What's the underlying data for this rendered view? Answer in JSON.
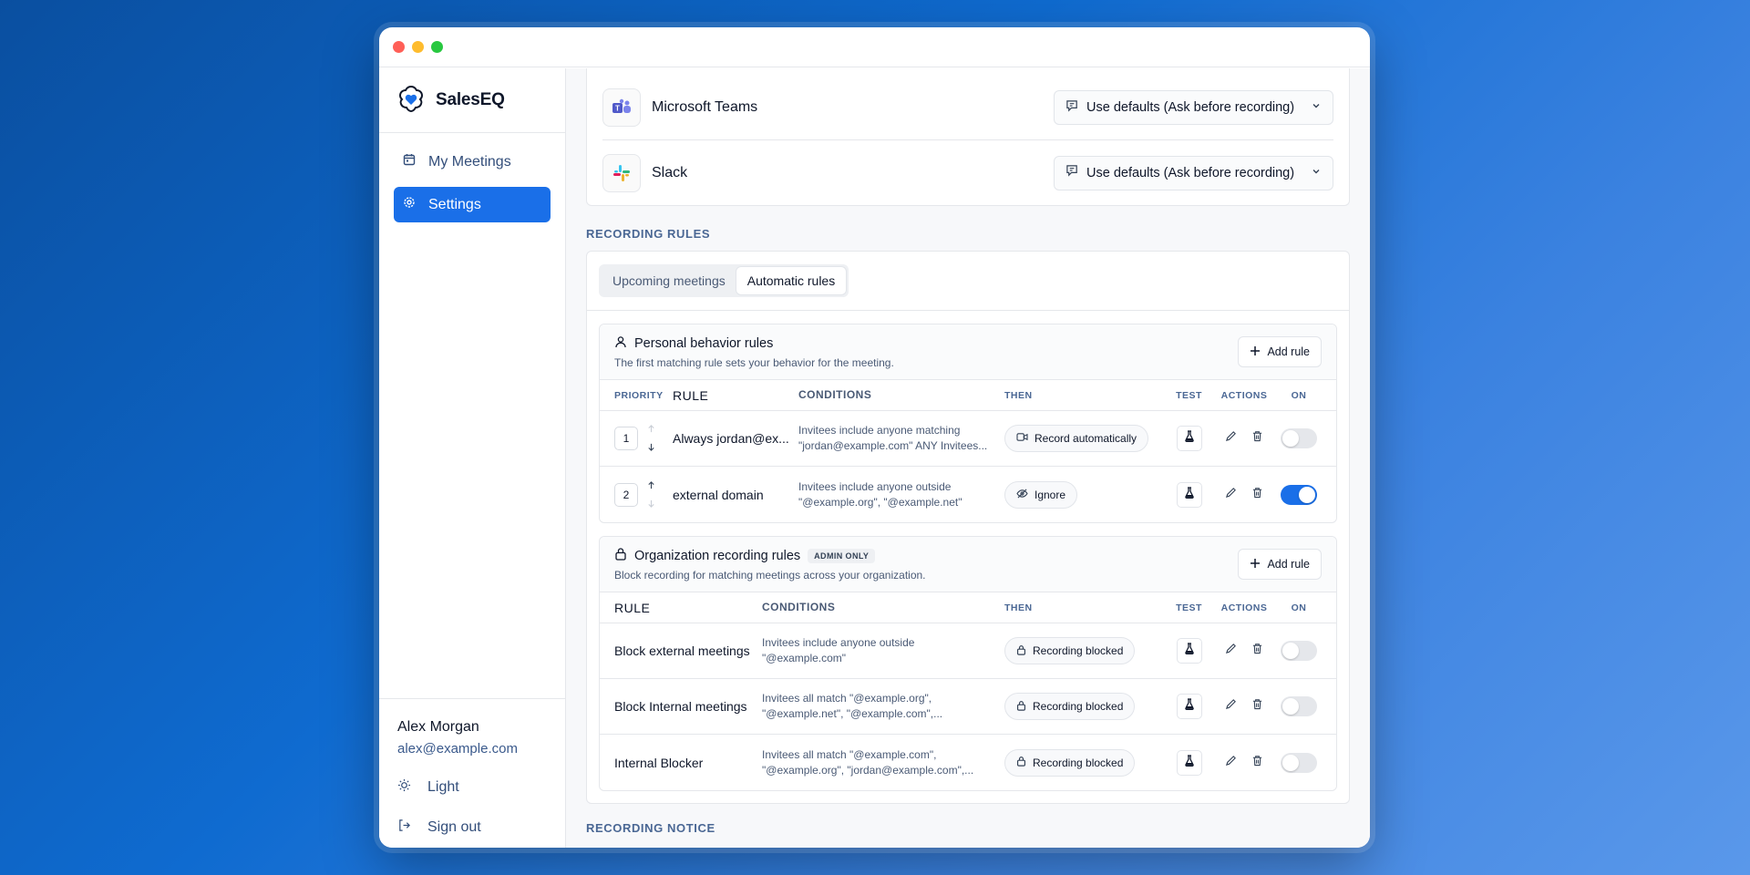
{
  "brand": {
    "name": "SalesEQ"
  },
  "nav": {
    "meetings": "My Meetings",
    "settings": "Settings"
  },
  "user": {
    "name": "Alex Morgan",
    "email": "alex@example.com"
  },
  "footer": {
    "theme": "Light",
    "signout": "Sign out"
  },
  "integrations": [
    {
      "name": "Microsoft Teams",
      "value": "Use defaults (Ask before recording)"
    },
    {
      "name": "Slack",
      "value": "Use defaults (Ask before recording)"
    }
  ],
  "recording_rules": {
    "title": "RECORDING RULES",
    "tabs": [
      "Upcoming meetings",
      "Automatic rules"
    ],
    "active_tab": "Automatic rules"
  },
  "personal": {
    "title": "Personal behavior rules",
    "subtitle": "The first matching rule sets your behavior for the meeting.",
    "add_label": "Add rule",
    "headers": {
      "priority": "PRIORITY",
      "rule": "RULE",
      "conditions": "CONDITIONS",
      "then": "THEN",
      "test": "TEST",
      "actions": "ACTIONS",
      "on": "ON"
    },
    "rows": [
      {
        "priority": "1",
        "rule": "Always jordan@ex...",
        "cond1": "Invitees include anyone matching",
        "cond2": "\"jordan@example.com\" ANY Invitees...",
        "then": "Record automatically",
        "on": false
      },
      {
        "priority": "2",
        "rule": "external domain",
        "cond1": "Invitees include anyone outside",
        "cond2": "\"@example.org\", \"@example.net\"",
        "then": "Ignore",
        "on": true
      }
    ]
  },
  "org": {
    "title": "Organization recording rules",
    "badge": "ADMIN ONLY",
    "subtitle": "Block recording for matching meetings across your organization.",
    "add_label": "Add rule",
    "headers": {
      "rule": "RULE",
      "conditions": "CONDITIONS",
      "then": "THEN",
      "test": "TEST",
      "actions": "ACTIONS",
      "on": "ON"
    },
    "rows": [
      {
        "rule": "Block external meetings",
        "cond1": "Invitees include anyone outside",
        "cond2": "\"@example.com\"",
        "then": "Recording blocked",
        "on": false
      },
      {
        "rule": "Block Internal meetings",
        "cond1": "Invitees all match \"@example.org\",",
        "cond2": "\"@example.net\", \"@example.com\",...",
        "then": "Recording blocked",
        "on": false
      },
      {
        "rule": "Internal Blocker",
        "cond1": "Invitees all match \"@example.com\",",
        "cond2": "\"@example.org\", \"jordan@example.com\",...",
        "then": "Recording blocked",
        "on": false
      }
    ]
  },
  "recording_notice": {
    "title": "RECORDING NOTICE"
  },
  "colors": {
    "accent": "#1a6fe8",
    "toggle_off": "#e5e7eb"
  }
}
